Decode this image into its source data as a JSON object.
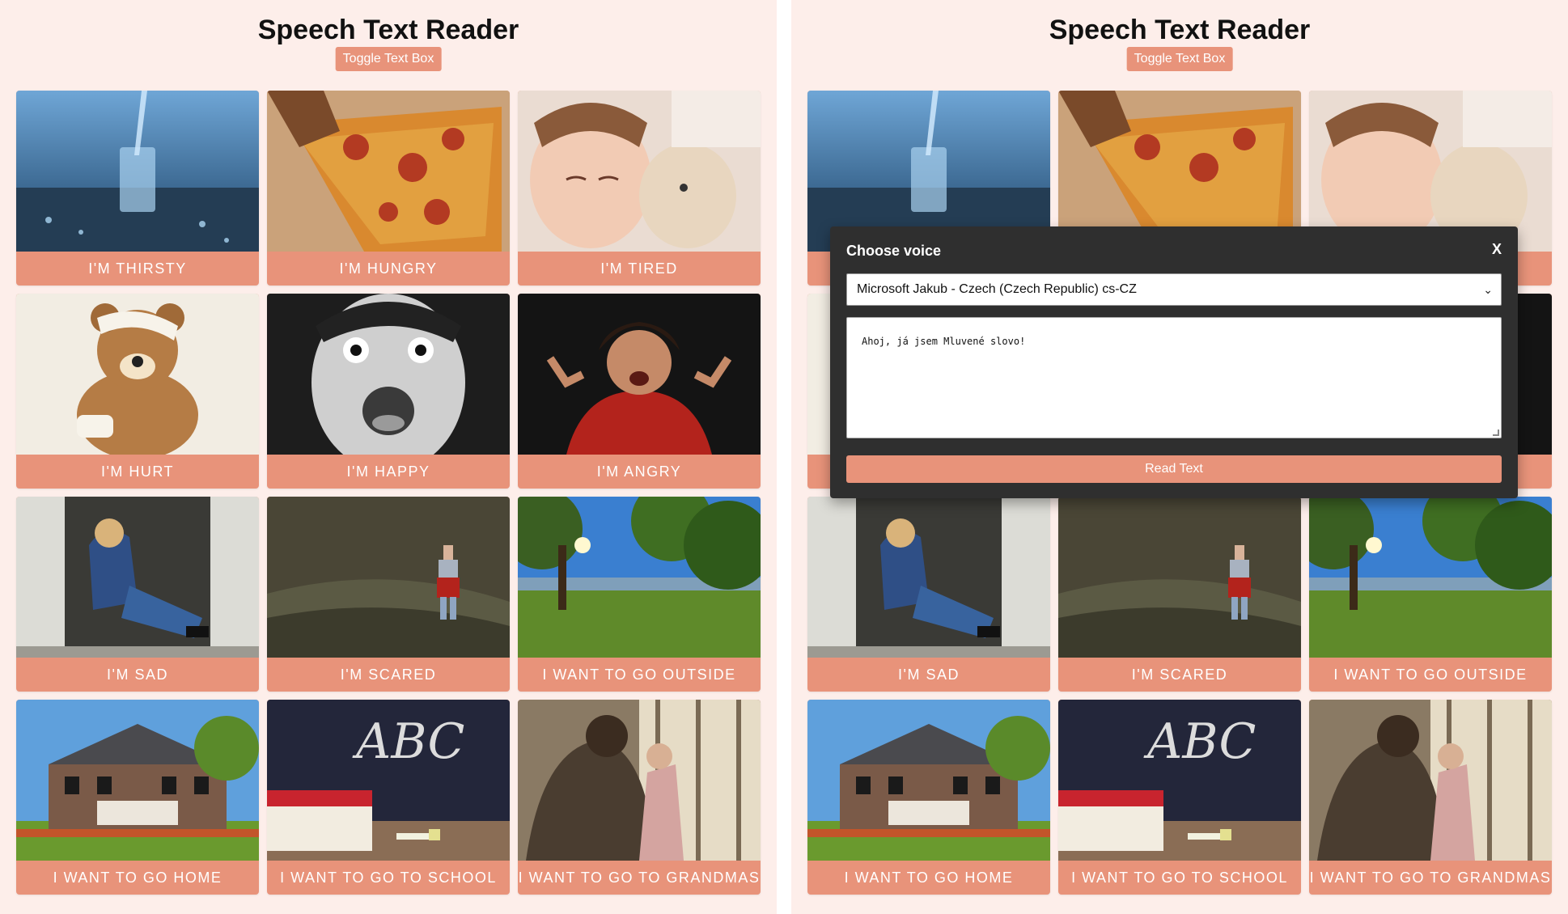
{
  "app": {
    "title": "Speech Text Reader",
    "toggle_label": "Toggle Text Box"
  },
  "cards": [
    {
      "label": "I'm Thirsty",
      "icon": "water-glass-image"
    },
    {
      "label": "I'm Hungry",
      "icon": "pizza-image"
    },
    {
      "label": "I'm Tired",
      "icon": "sleeping-child-image"
    },
    {
      "label": "I'm Hurt",
      "icon": "bandaged-teddy-bear-image"
    },
    {
      "label": "I'm Happy",
      "icon": "excited-boy-image"
    },
    {
      "label": "I'm Angry",
      "icon": "angry-boy-image"
    },
    {
      "label": "I'm Sad",
      "icon": "sad-child-in-doorway-image"
    },
    {
      "label": "I'm Scared",
      "icon": "child-alone-in-field-image"
    },
    {
      "label": "I Want To Go Outside",
      "icon": "park-sunlight-image"
    },
    {
      "label": "I Want To Go Home",
      "icon": "house-image"
    },
    {
      "label": "I Want To Go To School",
      "icon": "chalkboard-books-image"
    },
    {
      "label": "I Want To Go To Grandmas",
      "icon": "grandmother-child-image"
    }
  ],
  "chalkboard_text": "ABC",
  "modal": {
    "title": "Choose voice",
    "close_label": "X",
    "selected_voice": "Microsoft Jakub - Czech (Czech Republic) cs-CZ",
    "text_value": "Ahoj, já jsem Mluvené slovo!",
    "read_label": "Read Text"
  },
  "colors": {
    "background": "#fdeeea",
    "accent": "#e8937a",
    "modal_bg": "#2f2f2f"
  }
}
